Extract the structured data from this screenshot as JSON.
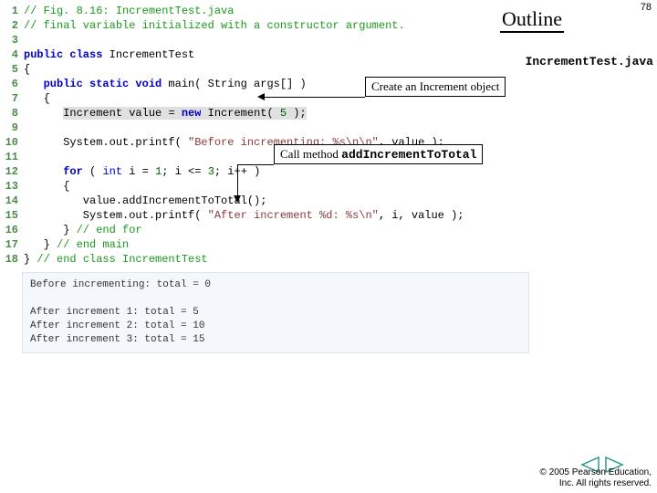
{
  "header": {
    "outline_label": "Outline",
    "page_number": "78",
    "filename": "IncrementTest.java"
  },
  "callouts": {
    "create_obj": "Create an Increment object",
    "call_method_prefix": "Call method ",
    "call_method_name": "addIncrementToTotal"
  },
  "code": {
    "lines": [
      {
        "n": "1",
        "tokens": [
          {
            "t": "// Fig. 8.16: IncrementTest.java",
            "c": "c-comment"
          }
        ]
      },
      {
        "n": "2",
        "tokens": [
          {
            "t": "// final variable initialized with a constructor argument.",
            "c": "c-comment"
          }
        ]
      },
      {
        "n": "3",
        "tokens": [
          {
            "t": " ",
            "c": "c-plain"
          }
        ]
      },
      {
        "n": "4",
        "tokens": [
          {
            "t": "public class",
            "c": "c-key"
          },
          {
            "t": " IncrementTest",
            "c": "c-plain"
          }
        ]
      },
      {
        "n": "5",
        "tokens": [
          {
            "t": "{",
            "c": "c-plain"
          }
        ]
      },
      {
        "n": "6",
        "tokens": [
          {
            "t": "   ",
            "c": "c-plain"
          },
          {
            "t": "public static void",
            "c": "c-key"
          },
          {
            "t": " main( String args[] )",
            "c": "c-plain"
          }
        ]
      },
      {
        "n": "7",
        "tokens": [
          {
            "t": "   {",
            "c": "c-plain"
          }
        ]
      },
      {
        "n": "8",
        "tokens": [
          {
            "t": "      ",
            "c": "c-plain"
          },
          {
            "t": "Increment value = ",
            "c": "c-plain hl"
          },
          {
            "t": "new",
            "c": "c-key hl"
          },
          {
            "t": " Increment( ",
            "c": "c-plain hl"
          },
          {
            "t": "5",
            "c": "c-num hl"
          },
          {
            "t": " );",
            "c": "c-plain hl"
          }
        ]
      },
      {
        "n": "9",
        "tokens": [
          {
            "t": " ",
            "c": "c-plain"
          }
        ]
      },
      {
        "n": "10",
        "tokens": [
          {
            "t": "      System.out.printf( ",
            "c": "c-plain"
          },
          {
            "t": "\"Before incrementing: %s\\n\\n\"",
            "c": "c-str"
          },
          {
            "t": ", value );",
            "c": "c-plain"
          }
        ]
      },
      {
        "n": "11",
        "tokens": [
          {
            "t": " ",
            "c": "c-plain"
          }
        ]
      },
      {
        "n": "12",
        "tokens": [
          {
            "t": "      ",
            "c": "c-plain"
          },
          {
            "t": "for",
            "c": "c-key"
          },
          {
            "t": " ( ",
            "c": "c-plain"
          },
          {
            "t": "int",
            "c": "c-type"
          },
          {
            "t": " i = ",
            "c": "c-plain"
          },
          {
            "t": "1",
            "c": "c-num"
          },
          {
            "t": "; i <= ",
            "c": "c-plain"
          },
          {
            "t": "3",
            "c": "c-num"
          },
          {
            "t": "; i++ )",
            "c": "c-plain"
          }
        ]
      },
      {
        "n": "13",
        "tokens": [
          {
            "t": "      {",
            "c": "c-plain"
          }
        ]
      },
      {
        "n": "14",
        "tokens": [
          {
            "t": "         value.addIncrementToTotal();",
            "c": "c-plain"
          }
        ]
      },
      {
        "n": "15",
        "tokens": [
          {
            "t": "         System.out.printf( ",
            "c": "c-plain"
          },
          {
            "t": "\"After increment %d: %s\\n\"",
            "c": "c-str"
          },
          {
            "t": ", i, value );",
            "c": "c-plain"
          }
        ]
      },
      {
        "n": "16",
        "tokens": [
          {
            "t": "      } ",
            "c": "c-plain"
          },
          {
            "t": "// end for",
            "c": "c-comment"
          }
        ]
      },
      {
        "n": "17",
        "tokens": [
          {
            "t": "   } ",
            "c": "c-plain"
          },
          {
            "t": "// end main",
            "c": "c-comment"
          }
        ]
      },
      {
        "n": "18",
        "tokens": [
          {
            "t": "} ",
            "c": "c-plain"
          },
          {
            "t": "// end class IncrementTest",
            "c": "c-comment"
          }
        ]
      }
    ]
  },
  "output": "Before incrementing: total = 0\n\nAfter increment 1: total = 5\nAfter increment 2: total = 10\nAfter increment 3: total = 15",
  "footer": {
    "line1": "© 2005 Pearson Education,",
    "line2": "Inc.  All rights reserved."
  },
  "nav": {
    "prev_color": "#2a9a8a",
    "next_color": "#2a9a8a"
  }
}
